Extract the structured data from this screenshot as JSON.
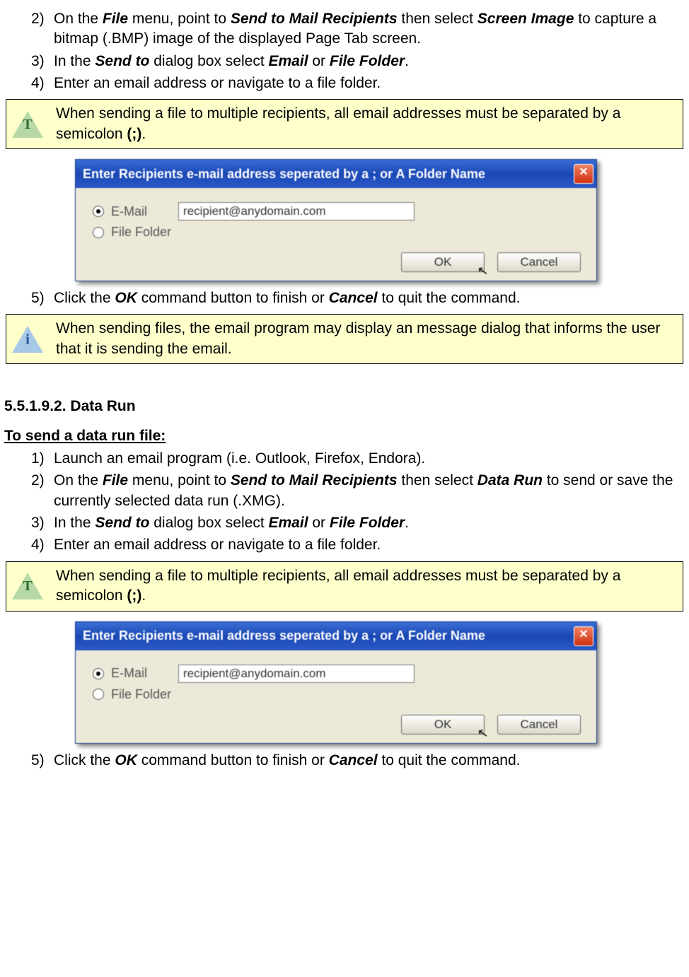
{
  "sectionA": {
    "steps": {
      "s2": {
        "num": "2)",
        "pre": "On the ",
        "b1": "File",
        "mid1": " menu, point to ",
        "b2": "Send to Mail Recipients",
        "mid2": " then select ",
        "b3": "Screen Image",
        "post": " to capture a bitmap (.BMP) image of the displayed Page Tab screen."
      },
      "s3": {
        "num": "3)",
        "pre": "In the ",
        "b1": "Send to",
        "mid1": " dialog box select ",
        "b2": "Email",
        "mid2": " or ",
        "b3": "File Folder",
        "post": "."
      },
      "s4": {
        "num": "4)",
        "text": "Enter an email address or navigate to a file folder."
      },
      "s5": {
        "num": "5)",
        "pre": "Click the ",
        "b1": "OK",
        "mid1": " command button to finish or ",
        "b2": "Cancel",
        "post": " to quit the command."
      }
    },
    "tip1": {
      "pre": "When sending a file to multiple recipients, all email addresses must be separated by a semicolon ",
      "b": "(;)",
      "post": "."
    },
    "info1": "When sending files, the email program may display an message dialog that informs the user that it is sending the email."
  },
  "dialog": {
    "title": "Enter Recipients e-mail address seperated by a ; or A Folder Name",
    "radio_email": "E-Mail",
    "radio_folder": "File Folder",
    "field_value": "recipient@anydomain.com",
    "ok": "OK",
    "cancel": "Cancel"
  },
  "sectionB": {
    "heading": "5.5.1.9.2. Data Run",
    "subheading": "To send a data run file:",
    "steps": {
      "s1": {
        "num": "1)",
        "text": "Launch an email program (i.e. Outlook, Firefox, Endora)."
      },
      "s2": {
        "num": "2)",
        "pre": "On the ",
        "b1": "File",
        "mid1": " menu, point to ",
        "b2": "Send to Mail Recipients",
        "mid2": " then select ",
        "b3": "Data Run",
        "post": " to send or save the currently selected data run (.XMG)."
      },
      "s3": {
        "num": "3)",
        "pre": "In the ",
        "b1": "Send to",
        "mid1": " dialog box select ",
        "b2": "Email",
        "mid2": " or ",
        "b3": "File Folder",
        "post": "."
      },
      "s4": {
        "num": "4)",
        "text": "Enter an email address or navigate to a file folder."
      },
      "s5": {
        "num": "5)",
        "pre": "Click the ",
        "b1": "OK",
        "mid1": " command button to finish or ",
        "b2": "Cancel",
        "post": " to quit the command."
      }
    },
    "tip1": {
      "pre": "When sending a file to multiple recipients, all email addresses must be separated by a semicolon ",
      "b": "(;)",
      "post": "."
    }
  }
}
